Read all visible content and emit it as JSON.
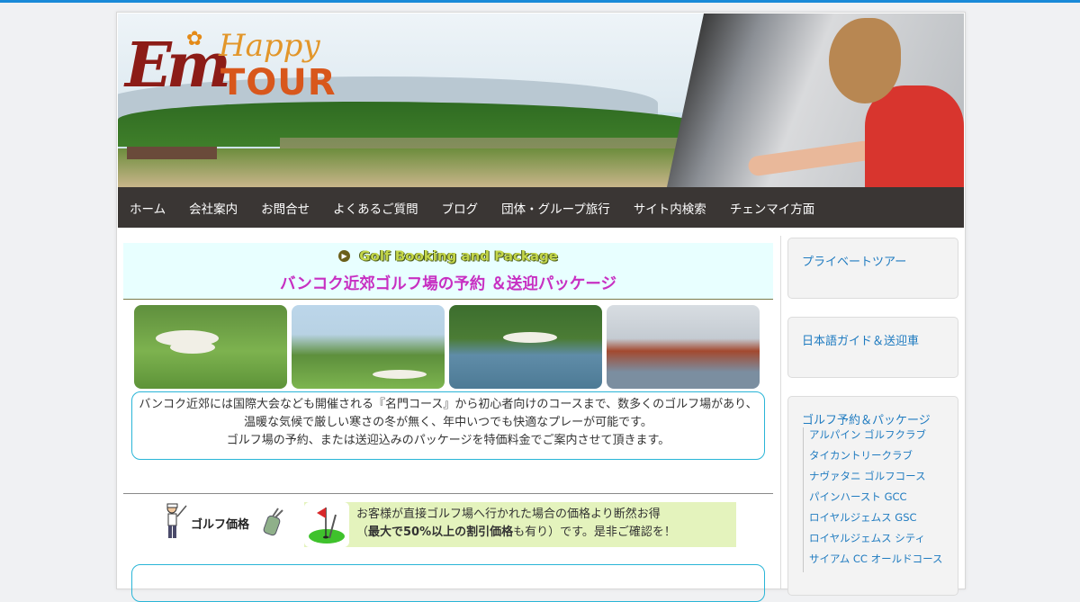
{
  "logo": {
    "mark": "Em",
    "happy": "Happy",
    "tour": "TOUR"
  },
  "nav": [
    "ホーム",
    "会社案内",
    "お問合せ",
    "よくあるご質問",
    "ブログ",
    "団体・グループ旅行",
    "サイト内検索",
    "チェンマイ方面"
  ],
  "golf": {
    "heading_en": "Golf Booking and Package",
    "heading_jp": "バンコク近郊ゴルフ場の予約 ＆送迎パッケージ",
    "intro": [
      "バンコク近郊には国際大会なども開催される『名門コース』から初心者向けのコースまで、数多くのゴルフ場があり、",
      "温暖な気候で厳しい寒さの冬が無く、年中いつでも快適なプレーが可能です。",
      "ゴルフ場の予約、または送迎込みのパッケージを特価料金でご案内させて頂きます。"
    ],
    "price_label": "ゴルフ価格",
    "notice_line1": "お客様が直接ゴルフ場へ行かれた場合の価格より断然お得",
    "notice_open": "（",
    "notice_bold": "最大で50%以上の割引価格",
    "notice_rest": "も有り）です。是非ご確認を！"
  },
  "sidebar": {
    "box1": "プライベートツアー",
    "box2": "日本語ガイド＆送迎車",
    "box3": {
      "title": "ゴルフ予約＆パッケージ",
      "items": [
        "アルパイン ゴルフクラブ",
        "タイカントリークラブ",
        "ナヴァタニ ゴルフコース",
        "パインハースト GCC",
        "ロイヤルジェムス GSC",
        "ロイヤルジェムス シティ",
        "サイアム CC オールドコース"
      ]
    }
  },
  "colors": {
    "accent": "#1a8ad8",
    "nav_bg": "#3a3634",
    "heading_jp": "#c72fc2",
    "link": "#1f7bc0",
    "notice_bg": "#e4f3bd",
    "frame": "#29b5d7"
  }
}
